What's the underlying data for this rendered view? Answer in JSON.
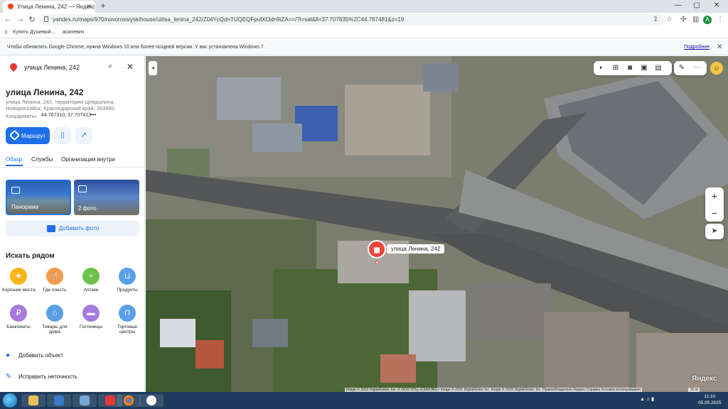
{
  "browser": {
    "tab_title": "Улица Ленина, 242 — Яндекс К...",
    "url": "yandex.ru/maps/970/novorossiysk/house/ulitsa_lenina_242/Z04YcQdnTUQEQFpufXt3dn9iZA==/?l=sat&ll=37.707835%2C44.767481&z=19",
    "bookmark_apps": "Сервисы",
    "bookmark_1": "Купить Душевой...",
    "bookmark_2": "асилевич",
    "info_message": "Чтобы обновлять Google Chrome, нужна Windows 10 или более поздней версии. У вас установлена Windows 7.",
    "info_link": "Подробнее",
    "profile_letter": "A"
  },
  "sidebar": {
    "search_value": "улица Ленина, 242",
    "title": "улица Ленина, 242",
    "address": "улица Ленина, 242, территория Цемдолина, Новороссийск, Краснодарский край, 353960",
    "coords_label": "Координаты:",
    "coords_value": "44.767310, 37.707413",
    "route_label": "Маршрут",
    "tabs": [
      "Обзор",
      "Службы",
      "Организации внутри"
    ],
    "panorama_label": "Панорама",
    "photos_label": "2 фото",
    "add_photo": "Добавить фото",
    "nearby_title": "Искать рядом",
    "categories": [
      {
        "label": "Хорошие места",
        "color": "#fbb419"
      },
      {
        "label": "Где поесть",
        "color": "#f59a4a"
      },
      {
        "label": "Аптеки",
        "color": "#6ec24b"
      },
      {
        "label": "Продукты",
        "color": "#5aa0e8"
      },
      {
        "label": "Банкоматы",
        "color": "#a77ae0"
      },
      {
        "label": "Товары для дома",
        "color": "#5aa0e8"
      },
      {
        "label": "Гостиницы",
        "color": "#a77ae0"
      },
      {
        "label": "Торговые центры",
        "color": "#5aa0e8"
      }
    ],
    "add_object": "Добавить объект",
    "report_error": "Исправить неточность"
  },
  "map": {
    "marker_label": "улица Ленина, 242",
    "logo": "Яндекс",
    "attribution": "Image © 2012 DigitalGlobe, Inc. © ООО НТЦ «СКАНЭКС» Image © 2021 DigitalGlobe Inc. Image © 2020 DigitalGlobe, Inc.  Правообладатели   Яндекс  Справка  Условия использования",
    "scale": "20 м"
  },
  "taskbar": {
    "time": "11:10",
    "date": "05.05.2025"
  },
  "colors": {
    "accent": "#1e6fe8",
    "marker": "#f0433a"
  }
}
